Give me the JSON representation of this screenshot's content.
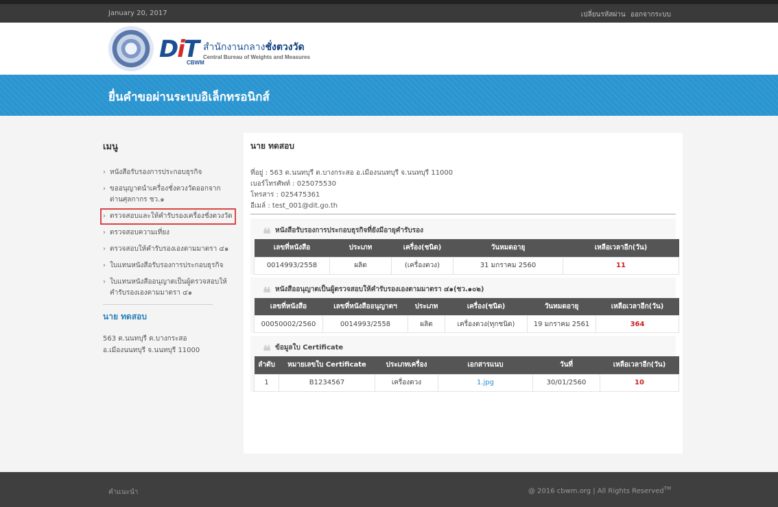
{
  "topbar": {
    "date": "January 20, 2017",
    "change_password": "เปลี่ยนรหัสผ่าน",
    "logout": "ออกจากระบบ"
  },
  "brand": {
    "logo_text_d": "D",
    "logo_text_i": "i",
    "logo_text_t": "T",
    "cbwm": "CBWM",
    "thai_prefix": "สำนักงานกลาง",
    "thai_bold": "ชั่งตวงวัด",
    "english": "Central Bureau of Weights and Measures"
  },
  "banner": {
    "title": "ยื่นคำขอผ่านระบบอิเล็กทรอนิกส์"
  },
  "sidebar": {
    "menu_title": "เมนู",
    "items": [
      {
        "label": "หนังสือรับรองการประกอบธุรกิจ"
      },
      {
        "label": "ขออนุญาตนำเครื่องชั่งตวงวัดออกจากด่านศุลกากร ชว.๑"
      },
      {
        "label": "ตรวจสอบและให้คำรับรองเครื่องชั่งตวงวัด"
      },
      {
        "label": "ตรวจสอบความเที่ยง"
      },
      {
        "label": "ตรวจสอบให้คำรับรองเองตามมาตรา ๔๑"
      },
      {
        "label": "ใบแทนหนังสือรับรองการประกอบธุรกิจ"
      },
      {
        "label": "ใบแทนหนังสืออนุญาตเป็นผู้ตรวจสอบให้คำรับรองเองตามมาตรา ๔๑"
      }
    ],
    "user_name": "นาย ทดสอบ",
    "address_line1": "563 ต.นนทบุรี ต.บางกระสอ",
    "address_line2": "อ.เมืองนนทบุรี จ.นนทบุรี 11000"
  },
  "content": {
    "name": "นาย ทดสอบ",
    "address": "ที่อยู่ : 563 ต.นนทบุรี ต.บางกระสอ อ.เมืองนนทบุรี จ.นนทบุรี 11000",
    "phone": "เบอร์โทรศัพท์ : 025075530",
    "fax": "โทรสาร : 025475361",
    "email": "อีเมล์ : test_001@dit.go.th",
    "quote_glyph": "❝",
    "section1": {
      "title": "หนังสือรับรองการประกอบธุรกิจที่ยังมีอายุคำรับรอง",
      "headers": [
        "เลขที่หนังสือ",
        "ประเภท",
        "เครื่อง(ชนิด)",
        "วันหมดอายุ",
        "เหลือเวลาอีก(วัน)"
      ],
      "rows": [
        [
          "0014993/2558",
          "ผลิต",
          "(เครื่องตวง)",
          "31 มกราคม 2560",
          "11"
        ]
      ]
    },
    "section2": {
      "title": "หนังสืออนุญาตเป็นผู้ตรวจสอบให้คำรับรองเองตามมาตรา ๔๑(ชว.๑๐๒)",
      "headers": [
        "เลขที่หนังสือ",
        "เลขที่หนังสืออนุญาตฯ",
        "ประเภท",
        "เครื่อง(ชนิด)",
        "วันหมดอายุ",
        "เหลือเวลาอีก(วัน)"
      ],
      "rows": [
        [
          "00050002/2560",
          "0014993/2558",
          "ผลิต",
          "เครื่องตวง(ทุกชนิด)",
          "19 มกราคม 2561",
          "364"
        ]
      ]
    },
    "section3": {
      "title": "ข้อมูลใบ Certificate",
      "headers": [
        "ลำดับ",
        "หมายเลขใบ Certificate",
        "ประเภทเครื่อง",
        "เอกสารแนบ",
        "วันที่",
        "เหลือเวลาอีก(วัน)"
      ],
      "rows": [
        [
          "1",
          "B1234567",
          "เครื่องตวง",
          "1.jpg",
          "30/01/2560",
          "10"
        ]
      ]
    }
  },
  "footer": {
    "left": "คำแนะนำ",
    "right": "@ 2016 cbwm.org | All Rights Reserved",
    "tm": "TM"
  },
  "colors": {
    "banner": "#2a95d0",
    "accent_red": "#cc1f1f",
    "link_blue": "#2a8bd0",
    "active_outline": "#d64545"
  }
}
